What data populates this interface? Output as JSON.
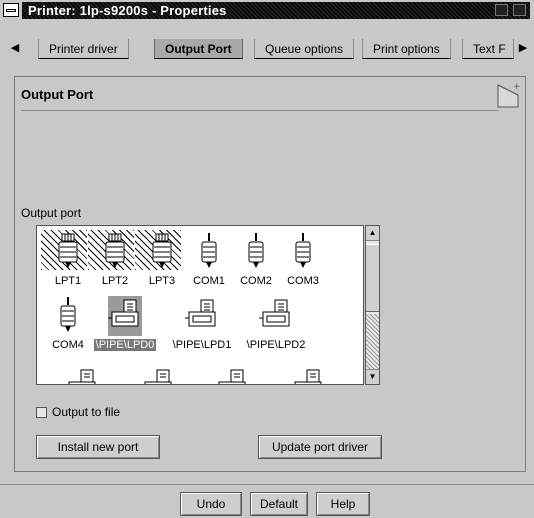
{
  "window": {
    "title": "Printer: 1lp-s9200s - Properties"
  },
  "tabs": [
    {
      "label": "Printer driver"
    },
    {
      "label": "Output Port"
    },
    {
      "label": "Queue options"
    },
    {
      "label": "Print options"
    },
    {
      "label": "Text F"
    }
  ],
  "panel": {
    "title": "Output Port",
    "port_list_label": "Output port"
  },
  "ports": [
    {
      "label": "LPT1",
      "icon": "parallel-port-icon"
    },
    {
      "label": "LPT2",
      "icon": "parallel-port-icon"
    },
    {
      "label": "LPT3",
      "icon": "parallel-port-icon"
    },
    {
      "label": "COM1",
      "icon": "serial-port-icon"
    },
    {
      "label": "COM2",
      "icon": "serial-port-icon"
    },
    {
      "label": "COM3",
      "icon": "serial-port-icon"
    },
    {
      "label": "COM4",
      "icon": "serial-port-icon"
    },
    {
      "label": "\\PIPE\\LPD0",
      "icon": "printer-icon",
      "selected": true
    },
    {
      "label": "\\PIPE\\LPD1",
      "icon": "printer-icon"
    },
    {
      "label": "\\PIPE\\LPD2",
      "icon": "printer-icon"
    }
  ],
  "options": {
    "output_to_file": "Output to file",
    "output_to_file_checked": false
  },
  "buttons": {
    "install": "Install new port",
    "update": "Update port driver",
    "undo": "Undo",
    "default": "Default",
    "help": "Help"
  }
}
